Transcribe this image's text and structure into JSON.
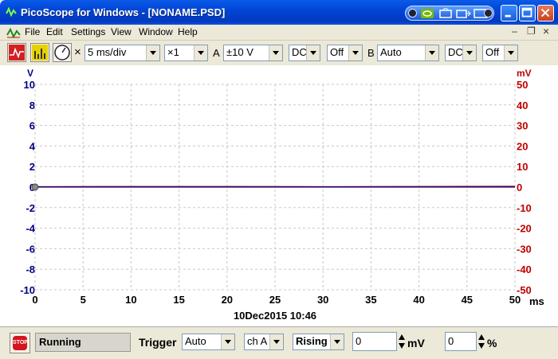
{
  "window": {
    "title": "PicoScope for Windows - [NONAME.PSD]"
  },
  "menu": {
    "items": [
      "File",
      "Edit",
      "Settings",
      "View",
      "Window",
      "Help"
    ],
    "mdi_controls": [
      "–",
      "❐",
      "×"
    ]
  },
  "toolbar": {
    "close_symbol": "×",
    "timebase": "5 ms/div",
    "zoom": "×1",
    "channel_a_label": "A",
    "channel_a_range": "±10 V",
    "channel_a_coupling": "DC",
    "channel_a_option": "Off",
    "channel_b_label": "B",
    "channel_b_range": "Auto",
    "channel_b_coupling": "DC",
    "channel_b_option": "Off"
  },
  "chart_data": {
    "type": "line",
    "left_axis": {
      "unit": "V",
      "ticks": [
        "10",
        "8",
        "6",
        "4",
        "2",
        "0",
        "-2",
        "-4",
        "-6",
        "-8",
        "-10"
      ],
      "ylim": [
        -10,
        10
      ],
      "color": "#000080"
    },
    "right_axis": {
      "unit": "mV",
      "ticks": [
        "50",
        "40",
        "30",
        "20",
        "10",
        "0",
        "-10",
        "-20",
        "-30",
        "-40",
        "-50"
      ],
      "ylim": [
        -50,
        50
      ],
      "color": "#c00000"
    },
    "x_axis": {
      "unit": "ms",
      "ticks": [
        "0",
        "5",
        "10",
        "15",
        "20",
        "25",
        "30",
        "35",
        "40",
        "45",
        "50"
      ],
      "xlim": [
        0,
        50
      ]
    },
    "grid": true,
    "timestamp": "10Dec2015  10:46",
    "series": [
      {
        "axis": "right",
        "color": "#b01020",
        "x": [
          0,
          10,
          20,
          30,
          40,
          50
        ],
        "values": [
          0.2,
          0.3,
          0.3,
          0.2,
          0.3,
          0.4
        ]
      },
      {
        "axis": "left",
        "color": "#000080",
        "x": [
          0,
          10,
          20,
          30,
          40,
          50
        ],
        "values": [
          0,
          0,
          0,
          0,
          0,
          0
        ]
      }
    ]
  },
  "statusbar": {
    "stop_label": "STOP",
    "status": "Running",
    "trigger_label": "Trigger",
    "trigger_mode": "Auto",
    "trigger_channel": "ch A",
    "trigger_edge": "Rising",
    "trigger_level": "0",
    "trigger_level_unit": "mV",
    "trigger_delay": "0",
    "trigger_delay_unit": "%"
  }
}
